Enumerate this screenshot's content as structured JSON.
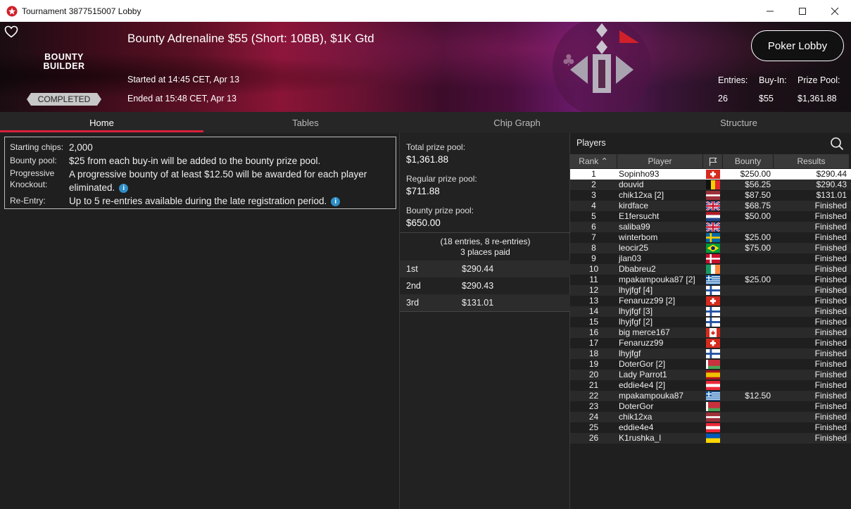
{
  "window": {
    "title": "Tournament 3877515007 Lobby",
    "minimize": "—",
    "maximize": "☐",
    "close": "✕"
  },
  "banner": {
    "logo_line1": "BOUNTY",
    "logo_line2": "BUILDER",
    "status": "COMPLETED",
    "tournament_title": "Bounty Adrenaline $55 (Short: 10BB), $1K Gtd",
    "started": "Started at 14:45 CET, Apr 13",
    "ended": "Ended at 15:48 CET, Apr 13",
    "poker_lobby_label": "Poker Lobby",
    "entries_label": "Entries:",
    "entries_value": "26",
    "buyin_label": "Buy-In:",
    "buyin_value": "$55",
    "prizepool_label": "Prize Pool:",
    "prizepool_value": "$1,361.88"
  },
  "tabs": [
    "Home",
    "Tables",
    "Chip Graph",
    "Structure"
  ],
  "info": {
    "starting_chips_label": "Starting chips:",
    "starting_chips_value": "2,000",
    "bounty_pool_label": "Bounty pool:",
    "bounty_pool_value": "$25 from each buy-in will be added to the bounty prize pool.",
    "pko_label_1": "Progressive",
    "pko_label_2": "Knockout:",
    "pko_value_1": "A progressive bounty of at least $12.50 will be awarded for each player",
    "pko_value_2": "eliminated.",
    "reentry_label": "Re-Entry:",
    "reentry_value": "Up to 5 re-entries available during the late registration period.",
    "info_glyph": "i"
  },
  "prizes": {
    "total_label": "Total prize pool:",
    "total_value": "$1,361.88",
    "regular_label": "Regular prize pool:",
    "regular_value": "$711.88",
    "bounty_label": "Bounty prize pool:",
    "bounty_value": "$650.00",
    "entries_note": "(18 entries, 8 re-entries)",
    "places_paid": "3 places paid",
    "places": [
      {
        "place": "1st",
        "amount": "$290.44"
      },
      {
        "place": "2nd",
        "amount": "$290.43"
      },
      {
        "place": "3rd",
        "amount": "$131.01"
      }
    ]
  },
  "players": {
    "title": "Players",
    "headers": {
      "rank": "Rank",
      "player": "Player",
      "bounty": "Bounty",
      "results": "Results"
    },
    "rows": [
      {
        "rank": "1",
        "player": "Sopinho93",
        "flag": "ch",
        "bounty": "$250.00",
        "result": "$290.44"
      },
      {
        "rank": "2",
        "player": "douvid",
        "flag": "be",
        "bounty": "$56.25",
        "result": "$290.43"
      },
      {
        "rank": "3",
        "player": "chik12xa [2]",
        "flag": "lv",
        "bounty": "$87.50",
        "result": "$131.01"
      },
      {
        "rank": "4",
        "player": "kirdface",
        "flag": "gb",
        "bounty": "$68.75",
        "result": "Finished"
      },
      {
        "rank": "5",
        "player": "E1fersucht",
        "flag": "nl",
        "bounty": "$50.00",
        "result": "Finished"
      },
      {
        "rank": "6",
        "player": "saliba99",
        "flag": "gb",
        "bounty": "",
        "result": "Finished"
      },
      {
        "rank": "7",
        "player": "winterbom",
        "flag": "se",
        "bounty": "$25.00",
        "result": "Finished"
      },
      {
        "rank": "8",
        "player": "leocir25",
        "flag": "br",
        "bounty": "$75.00",
        "result": "Finished"
      },
      {
        "rank": "9",
        "player": "jlan03",
        "flag": "dk",
        "bounty": "",
        "result": "Finished"
      },
      {
        "rank": "10",
        "player": "Dbabreu2",
        "flag": "ie",
        "bounty": "",
        "result": "Finished"
      },
      {
        "rank": "11",
        "player": "mpakampouka87 [2]",
        "flag": "gr",
        "bounty": "$25.00",
        "result": "Finished"
      },
      {
        "rank": "12",
        "player": "lhyjfgf [4]",
        "flag": "fi",
        "bounty": "",
        "result": "Finished"
      },
      {
        "rank": "13",
        "player": "Fenaruzz99 [2]",
        "flag": "ch",
        "bounty": "",
        "result": "Finished"
      },
      {
        "rank": "14",
        "player": "lhyjfgf [3]",
        "flag": "fi",
        "bounty": "",
        "result": "Finished"
      },
      {
        "rank": "15",
        "player": "lhyjfgf [2]",
        "flag": "fi",
        "bounty": "",
        "result": "Finished"
      },
      {
        "rank": "16",
        "player": "big merce167",
        "flag": "ca",
        "bounty": "",
        "result": "Finished"
      },
      {
        "rank": "17",
        "player": "Fenaruzz99",
        "flag": "ch",
        "bounty": "",
        "result": "Finished"
      },
      {
        "rank": "18",
        "player": "lhyjfgf",
        "flag": "fi",
        "bounty": "",
        "result": "Finished"
      },
      {
        "rank": "19",
        "player": "DoterGor [2]",
        "flag": "by",
        "bounty": "",
        "result": "Finished"
      },
      {
        "rank": "20",
        "player": "Lady Parrot1",
        "flag": "es",
        "bounty": "",
        "result": "Finished"
      },
      {
        "rank": "21",
        "player": "eddie4e4 [2]",
        "flag": "at",
        "bounty": "",
        "result": "Finished"
      },
      {
        "rank": "22",
        "player": "mpakampouka87",
        "flag": "gr",
        "bounty": "$12.50",
        "result": "Finished"
      },
      {
        "rank": "23",
        "player": "DoterGor",
        "flag": "by",
        "bounty": "",
        "result": "Finished"
      },
      {
        "rank": "24",
        "player": "chik12xa",
        "flag": "lv",
        "bounty": "",
        "result": "Finished"
      },
      {
        "rank": "25",
        "player": "eddie4e4",
        "flag": "at",
        "bounty": "",
        "result": "Finished"
      },
      {
        "rank": "26",
        "player": "K1rushka_l",
        "flag": "ua",
        "bounty": "",
        "result": "Finished"
      }
    ]
  },
  "colors": {
    "accent_red": "#d8203a",
    "info_blue": "#2e8fc7",
    "selected_row": "#ffffff"
  }
}
